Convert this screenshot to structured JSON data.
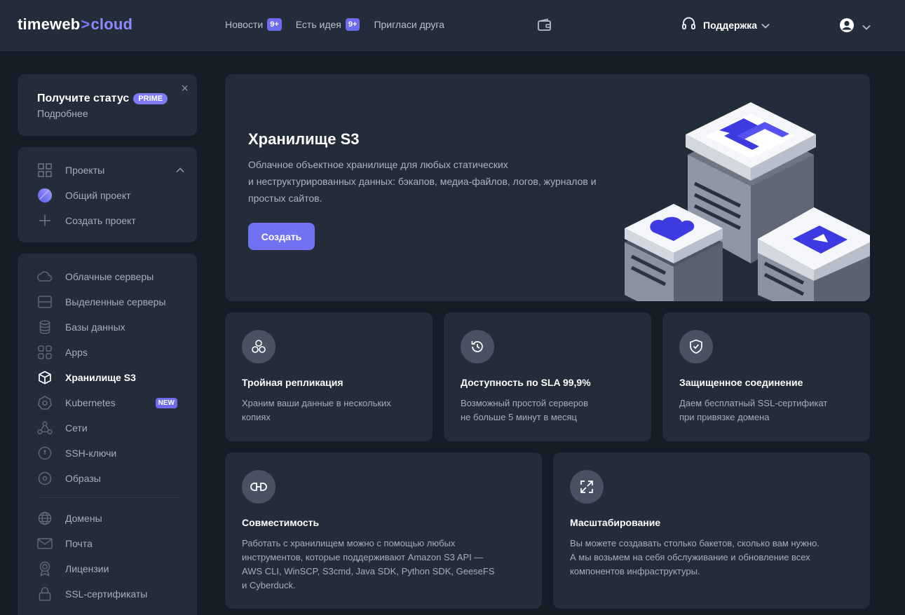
{
  "header": {
    "logo": {
      "part1": "timeweb",
      "arrow": ">",
      "part2": "cloud"
    },
    "nav": [
      {
        "label": "Новости",
        "badge": "9+"
      },
      {
        "label": "Есть идея",
        "badge": "9+"
      },
      {
        "label": "Пригласи друга"
      }
    ],
    "support_label": "Поддержка"
  },
  "promo": {
    "title": "Получите статус",
    "badge": "PRIME",
    "link": "Подробнее",
    "close": "×"
  },
  "projects": {
    "header": "Проекты",
    "items": [
      {
        "label": "Общий проект",
        "icon": "project-avatar-icon"
      },
      {
        "label": "Создать проект",
        "icon": "plus-icon"
      }
    ]
  },
  "sidebar": {
    "items": [
      {
        "label": "Облачные серверы",
        "icon": "cloud-icon"
      },
      {
        "label": "Выделенные серверы",
        "icon": "server-icon"
      },
      {
        "label": "Базы данных",
        "icon": "database-icon"
      },
      {
        "label": "Apps",
        "icon": "apps-icon"
      },
      {
        "label": "Хранилище S3",
        "icon": "cube-icon",
        "active": true
      },
      {
        "label": "Kubernetes",
        "icon": "kubernetes-icon",
        "badge": "NEW"
      },
      {
        "label": "Сети",
        "icon": "network-icon"
      },
      {
        "label": "SSH-ключи",
        "icon": "key-icon"
      },
      {
        "label": "Образы",
        "icon": "disk-icon"
      },
      {
        "label": "Домены",
        "icon": "globe-icon"
      },
      {
        "label": "Почта",
        "icon": "mail-icon"
      },
      {
        "label": "Лицензии",
        "icon": "license-icon"
      },
      {
        "label": "SSL-сертификаты",
        "icon": "lock-icon"
      }
    ]
  },
  "hero": {
    "title": "Хранилище S3",
    "description_line1": "Облачное объектное хранилище для любых статических",
    "description_line2": "и неструктурированных данных: бэкапов, медиа-файлов, логов, журналов и",
    "description_line3": "простых сайтов.",
    "button": "Создать"
  },
  "features": [
    {
      "title": "Тройная репликация",
      "desc1": "Храним ваши данные в нескольких",
      "desc2": "копиях",
      "icon": "replication-icon"
    },
    {
      "title": "Доступность по SLA 99,9%",
      "desc1": "Возможный простой серверов",
      "desc2": "не больше 5 минут в месяц",
      "icon": "history-icon"
    },
    {
      "title": "Защищенное соединение",
      "desc1": "Даем бесплатный SSL-сертификат",
      "desc2": "при привязке домена",
      "icon": "shield-check-icon"
    }
  ],
  "features2": [
    {
      "title": "Совместимость",
      "desc1": "Работать с хранилищем можно с помощью любых",
      "desc2": "инструментов, которые поддерживают Amazon S3 API —",
      "desc3": "AWS CLI, WinSCP, S3cmd, Java SDK, Python SDK, GeeseFS",
      "desc4": "и Cyberduck.",
      "icon": "compatibility-icon"
    },
    {
      "title": "Масштабирование",
      "desc1": "Вы можете создавать столько бакетов, сколько вам нужно.",
      "desc2": "А мы возьмем на себя обслуживание и обновление всех",
      "desc3": "компонентов инфраструктуры.",
      "icon": "scale-icon"
    }
  ],
  "colors": {
    "accent": "#7271f4",
    "background": "#161d26",
    "card": "#232c39"
  }
}
